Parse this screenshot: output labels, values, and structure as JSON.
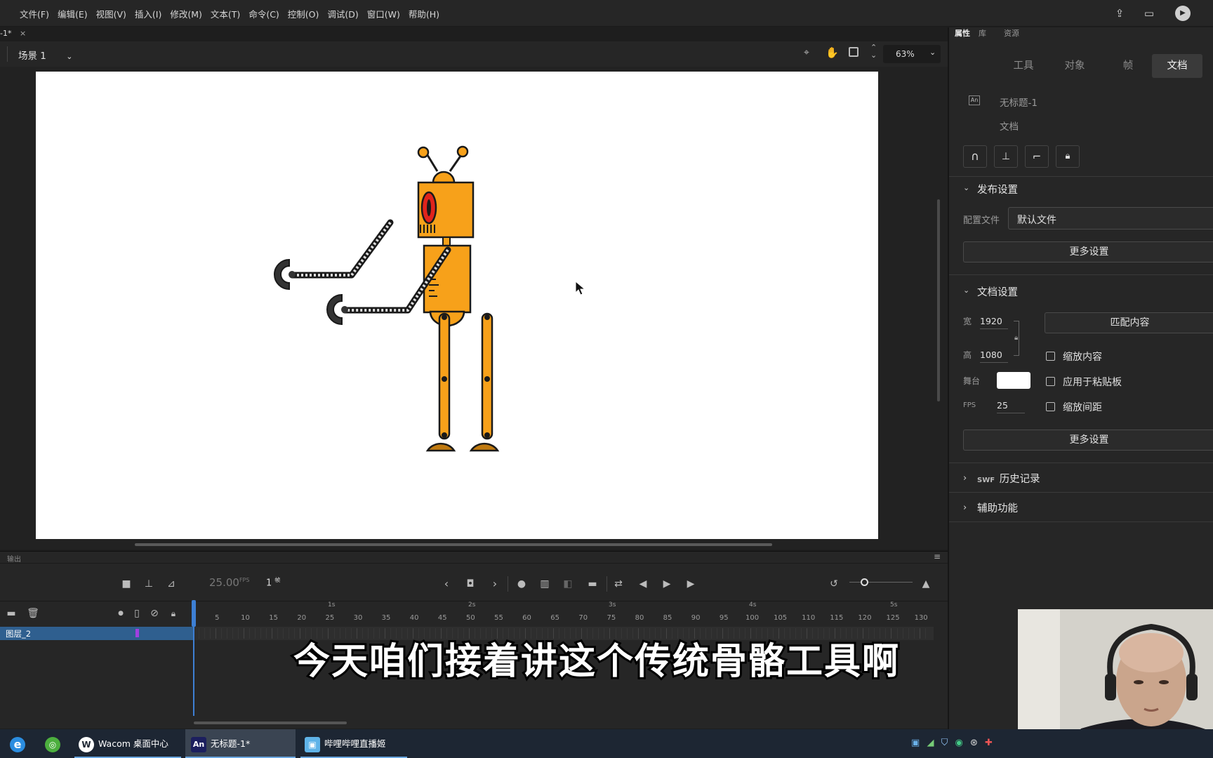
{
  "menubar": {
    "items": [
      "文件(F)",
      "编辑(E)",
      "视图(V)",
      "插入(I)",
      "修改(M)",
      "文本(T)",
      "命令(C)",
      "控制(O)",
      "调试(D)",
      "窗口(W)",
      "帮助(H)"
    ]
  },
  "doc_tab": {
    "label": "-1*",
    "close": "×"
  },
  "scene": {
    "label": "场景 1",
    "zoom": "63%"
  },
  "panel": {
    "tabs": [
      "属性",
      "库",
      "资源"
    ],
    "subtabs": [
      "工具",
      "对象",
      "帧",
      "文档"
    ],
    "active_subtab": "文档",
    "doc_name": "无标题-1",
    "doc_type": "文档",
    "publish": {
      "title": "发布设置",
      "profile_label": "配置文件",
      "profile_value": "默认文件",
      "more_btn": "更多设置"
    },
    "docsettings": {
      "title": "文档设置",
      "width_label": "宽",
      "width_value": "1920",
      "height_label": "高",
      "height_value": "1080",
      "match_btn": "匹配内容",
      "scale_content": "缩放内容",
      "apply_paste": "应用于粘贴板",
      "scale_spacing": "缩放间距",
      "stage_label": "舞台",
      "fps_label": "FPS",
      "fps_value": "25",
      "more_btn": "更多设置"
    },
    "swf_history": {
      "prefix": "SWF",
      "label": "历史记录"
    },
    "accessibility": "辅助功能"
  },
  "timeline": {
    "output_label": "输出",
    "fps": "25.00",
    "fps_unit": "FPS",
    "frame": "1",
    "frame_unit": "帧",
    "second_marks": [
      "1s",
      "2s",
      "3s",
      "4s",
      "5s"
    ],
    "frame_ticks": [
      "5",
      "10",
      "15",
      "20",
      "25",
      "30",
      "35",
      "40",
      "45",
      "50",
      "55",
      "60",
      "65",
      "70",
      "75",
      "80",
      "85",
      "90",
      "95",
      "100",
      "105",
      "110",
      "115",
      "120",
      "125",
      "130"
    ],
    "layer_name": "图层_2"
  },
  "subtitle": "今天咱们接着讲这个传统骨骼工具啊",
  "taskbar": {
    "items": [
      "Wacom 桌面中心",
      "无标题-1*",
      "哔哩哔哩直播姬"
    ]
  },
  "colors": {
    "robot_orange": "#f7a11a",
    "robot_outline": "#1a1a1a",
    "robot_eye": "#e0241c",
    "layer_highlight": "#2f5f8f",
    "playhead": "#3d7fd4"
  }
}
